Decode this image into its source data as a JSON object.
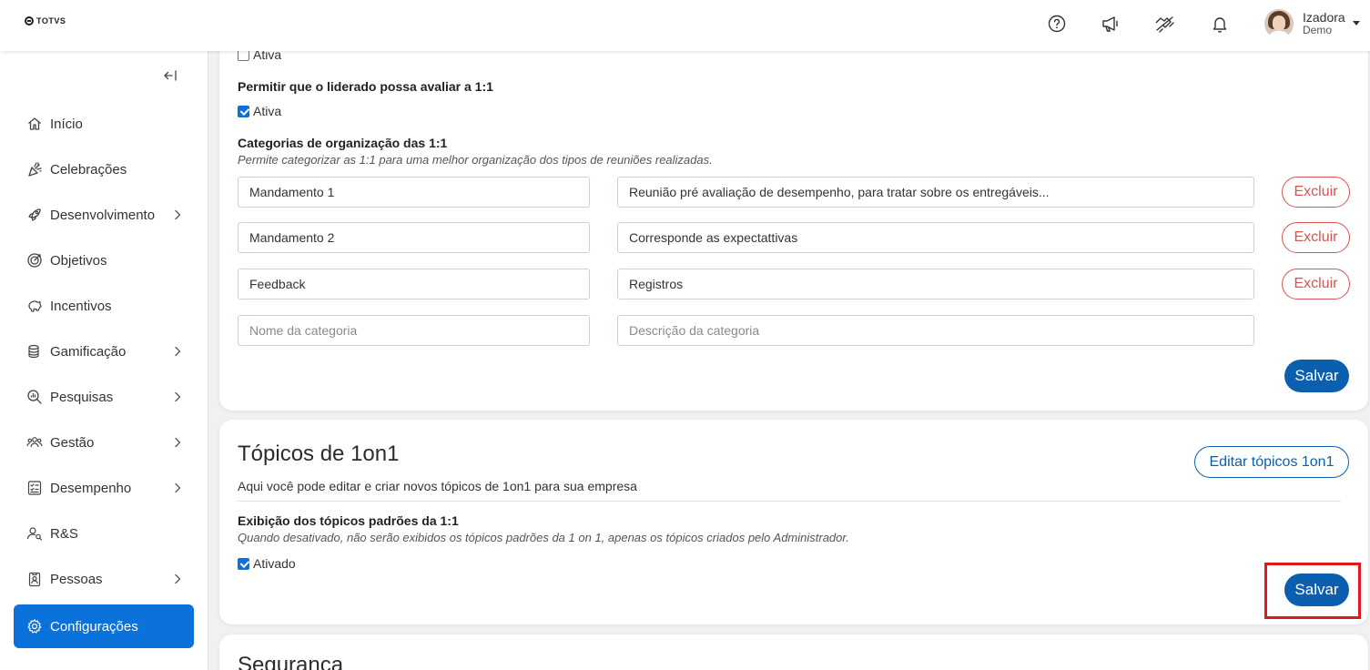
{
  "header": {
    "logo_text": "TOTVS",
    "icons": [
      "help-icon",
      "megaphone-icon",
      "handshake-icon",
      "bell-icon"
    ],
    "user": {
      "name": "Izadora",
      "role": "Demo"
    }
  },
  "sidebar": {
    "items": [
      {
        "label": "Início",
        "icon": "home-icon",
        "has_children": false
      },
      {
        "label": "Celebrações",
        "icon": "party-icon",
        "has_children": false
      },
      {
        "label": "Desenvolvimento",
        "icon": "rocket-icon",
        "has_children": true
      },
      {
        "label": "Objetivos",
        "icon": "target-icon",
        "has_children": false
      },
      {
        "label": "Incentivos",
        "icon": "piggy-bank-icon",
        "has_children": false
      },
      {
        "label": "Gamificação",
        "icon": "coins-icon",
        "has_children": true
      },
      {
        "label": "Pesquisas",
        "icon": "search-chart-icon",
        "has_children": true
      },
      {
        "label": "Gestão",
        "icon": "people-icon",
        "has_children": true
      },
      {
        "label": "Desempenho",
        "icon": "checklist-icon",
        "has_children": true
      },
      {
        "label": "R&S",
        "icon": "user-search-icon",
        "has_children": false
      },
      {
        "label": "Pessoas",
        "icon": "badge-icon",
        "has_children": true
      },
      {
        "label": "Configurações",
        "icon": "gear-icon",
        "has_children": false,
        "active": true
      }
    ]
  },
  "settings": {
    "top_checkbox_label": "Ativa",
    "allow_rating": {
      "title": "Permitir que o liderado possa avaliar a 1:1",
      "checkbox_label": "Ativa",
      "checked": true
    },
    "categories": {
      "title": "Categorias de organização das 1:1",
      "description": "Permite categorizar as 1:1 para uma melhor organização dos tipos de reuniões realizadas.",
      "rows": [
        {
          "name": "Mandamento 1",
          "description": "Reunião pré avaliação de desempenho, para tratar sobre os entregáveis..."
        },
        {
          "name": "Mandamento 2",
          "description": "Corresponde as expectattivas"
        },
        {
          "name": "Feedback",
          "description": "Registros"
        }
      ],
      "delete_label": "Excluir",
      "new_name_placeholder": "Nome da categoria",
      "new_description_placeholder": "Descrição da categoria",
      "save_label": "Salvar"
    }
  },
  "topics": {
    "title": "Tópicos de 1on1",
    "subtitle": "Aqui você pode editar e criar novos tópicos de 1on1 para sua empresa",
    "edit_button": "Editar tópicos 1on1",
    "default_topics": {
      "title": "Exibição dos tópicos padrões da 1:1",
      "description": "Quando desativado, não serão exibidos os tópicos padrões da 1 on 1, apenas os tópicos criados pelo Administrador.",
      "checkbox_label": "Ativado",
      "checked": true
    },
    "save_label": "Salvar"
  },
  "security": {
    "title": "Segurança"
  },
  "colors": {
    "primary": "#0c72db",
    "save_button": "#0b5fae",
    "danger": "#d9534f",
    "highlight": "#e0191e"
  }
}
